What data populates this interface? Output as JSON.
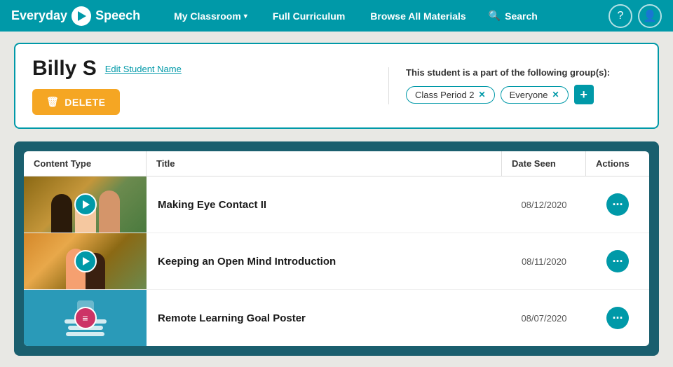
{
  "brand": {
    "name_part1": "Everyday",
    "name_part2": "Speech"
  },
  "nav": {
    "classroom_label": "My Classroom",
    "curriculum_label": "Full Curriculum",
    "browse_label": "Browse All Materials",
    "search_label": "Search"
  },
  "student": {
    "name": "Billy S",
    "edit_label": "Edit Student Name",
    "delete_label": "DELETE",
    "groups_heading": "This student is a part of the following group(s):",
    "groups": [
      {
        "name": "Class Period 2"
      },
      {
        "name": "Everyone"
      }
    ]
  },
  "table": {
    "col_content_type": "Content Type",
    "col_title": "Title",
    "col_date_seen": "Date Seen",
    "col_actions": "Actions",
    "rows": [
      {
        "title": "Making Eye Contact II",
        "date": "08/12/2020",
        "type": "video"
      },
      {
        "title": "Keeping an Open Mind Introduction",
        "date": "08/11/2020",
        "type": "video"
      },
      {
        "title": "Remote Learning Goal Poster",
        "date": "08/07/2020",
        "type": "document"
      }
    ]
  }
}
